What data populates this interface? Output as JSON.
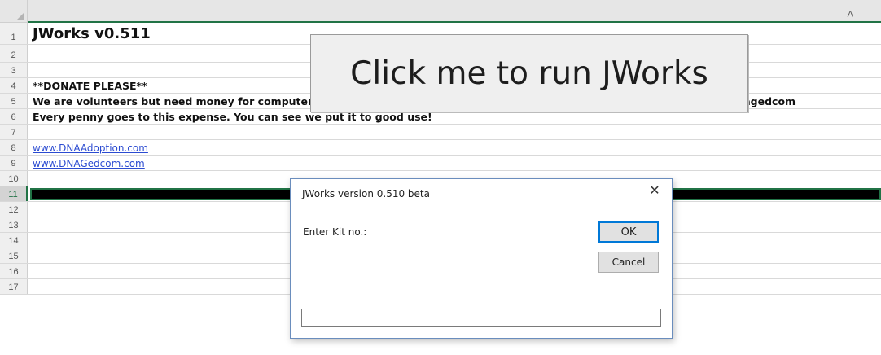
{
  "sheet": {
    "column_header": "A",
    "rows": [
      {
        "num": "1",
        "text": "JWorks v0.511"
      },
      {
        "num": "2",
        "text": ""
      },
      {
        "num": "3",
        "text": ""
      },
      {
        "num": "4",
        "text": "**DONATE PLEASE**"
      },
      {
        "num": "5",
        "text": "We are volunteers but need money for computer expense. Please donate through PAYPAL. Our account name is moodle@dnagedcom"
      },
      {
        "num": "6",
        "text": "Every penny goes to this expense. You can see we put it to good use!"
      },
      {
        "num": "7",
        "text": ""
      },
      {
        "num": "8",
        "text": "www.DNAAdoption.com"
      },
      {
        "num": "9",
        "text": "www.DNAGedcom.com"
      },
      {
        "num": "10",
        "text": ""
      },
      {
        "num": "11",
        "text": ""
      },
      {
        "num": "12",
        "text": ""
      },
      {
        "num": "13",
        "text": ""
      },
      {
        "num": "14",
        "text": ""
      },
      {
        "num": "15",
        "text": ""
      },
      {
        "num": "16",
        "text": ""
      },
      {
        "num": "17",
        "text": ""
      }
    ]
  },
  "run_button": {
    "label": "Click me to run JWorks"
  },
  "dialog": {
    "title": "JWorks version 0.510 beta",
    "close_glyph": "✕",
    "prompt": "Enter Kit no.:",
    "ok_label": "OK",
    "cancel_label": "Cancel",
    "input_value": ""
  },
  "colors": {
    "excel_green": "#217346",
    "link_blue": "#2b4bd1",
    "selected_row_fill": "#000000"
  }
}
